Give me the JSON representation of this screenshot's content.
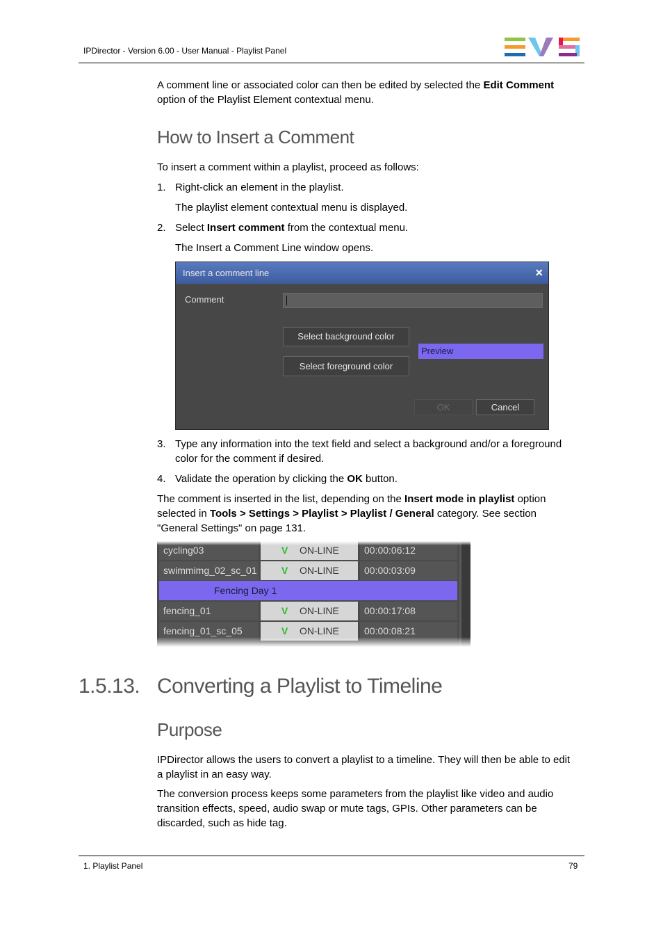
{
  "header": {
    "title": "IPDirector - Version 6.00 - User Manual - Playlist Panel",
    "logo": "EVS",
    "logo_colors": [
      "#8dc63f",
      "#f39c2c",
      "#1a6eb4",
      "#6ec6ee",
      "#9b7bbd",
      "#e5174b",
      "#e06fa0",
      "#8e2a8b"
    ]
  },
  "intro": {
    "text_before": "A comment line or associated color can then be edited by selected the ",
    "bold": "Edit Comment",
    "text_after": "option of the Playlist Element contextual menu."
  },
  "section_insert": {
    "heading": "How to Insert a Comment",
    "lead": "To insert a comment within a playlist, proceed as follows:",
    "steps": [
      {
        "num": "1.",
        "text": "Right-click an element in the playlist.",
        "result": "The playlist element contextual menu is displayed."
      },
      {
        "num": "2.",
        "text_before": "Select ",
        "bold": "Insert comment",
        "text_after": " from the contextual menu.",
        "result": "The Insert a Comment Line window opens."
      },
      {
        "num": "3.",
        "line1": "Type any information into the text field and select a background and/or a foreground",
        "line2": "color for the comment if desired."
      },
      {
        "num": "4.",
        "text_before": "Validate the operation by clicking the ",
        "bold": "OK",
        "text_after": " button."
      }
    ],
    "note": {
      "t1": "The comment is inserted in the list, depending on the ",
      "b1": "Insert mode in playlist",
      "t2": " option",
      "t3": "selected in ",
      "b2": "Tools > Settings > Playlist > Playlist / General",
      "t4": " category. See section",
      "t5": "\"General Settings\" on page 131."
    }
  },
  "dialog": {
    "title": "Insert a comment line",
    "close_icon": "×",
    "comment_label": "Comment",
    "comment_value": "",
    "bg_button": "Select background color",
    "fg_button": "Select foreground color",
    "preview": "Preview",
    "preview_color": "#7b68ee",
    "ok": "OK",
    "cancel": "Cancel"
  },
  "playlist": {
    "rows": [
      {
        "name": "cycling03",
        "check": "V",
        "status": "ON-LINE",
        "duration": "00:00:06:12"
      },
      {
        "name": "swimmimg_02_sc_01",
        "check": "V",
        "status": "ON-LINE",
        "duration": "00:00:03:09"
      },
      {
        "comment": "Fencing Day 1"
      },
      {
        "name": "fencing_01",
        "check": "V",
        "status": "ON-LINE",
        "duration": "00:00:17:08"
      },
      {
        "name": "fencing_01_sc_05",
        "check": "V",
        "status": "ON-LINE",
        "duration": "00:00:08:21"
      }
    ]
  },
  "section_convert": {
    "number": "1.5.13.",
    "heading": "Converting a Playlist to Timeline",
    "subheading": "Purpose",
    "p1_line1": "IPDirector allows the users to convert a playlist to a timeline. They will then be able to edit",
    "p1_line2": "a playlist in an easy way.",
    "p2_line1": "The conversion process keeps some parameters from the playlist like video and audio",
    "p2_line2": "transition effects, speed, audio swap or mute tags, GPIs. Other parameters can be",
    "p2_line3": "discarded, such as hide tag."
  },
  "footer": {
    "chapter": "1. Playlist Panel",
    "page": "79"
  }
}
